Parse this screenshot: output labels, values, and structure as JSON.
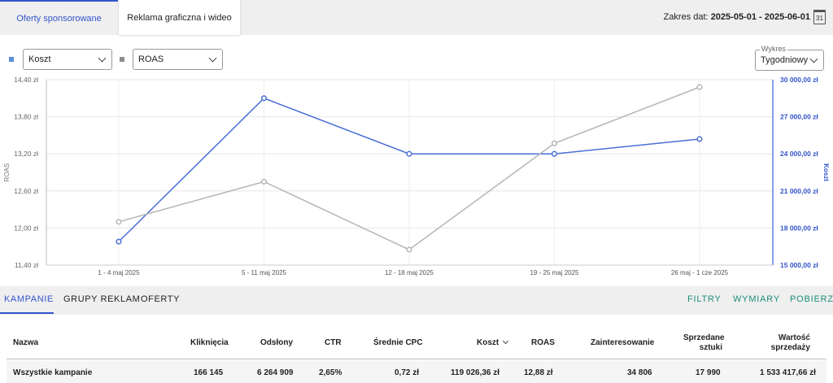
{
  "tabs": [
    {
      "label": "Oferty sponsorowane",
      "active": true
    },
    {
      "label": "Reklama graficzna i wideo",
      "active": false
    }
  ],
  "date_range": {
    "prefix": "Zakres dat:",
    "value": "2025-05-01 - 2025-06-01",
    "calendar_day": "31"
  },
  "controls": {
    "metric1": {
      "value": "Koszt",
      "color": "#5b8ed6"
    },
    "metric2": {
      "value": "ROAS",
      "color": "#8c8c8c"
    },
    "wykres": {
      "label": "Wykres",
      "value": "Tygodniowy"
    }
  },
  "chart_data": {
    "type": "line",
    "x": [
      "1 - 4 maj 2025",
      "5 - 11 maj 2025",
      "12 - 18 maj 2025",
      "19 - 25 maj 2025",
      "26 maj - 1 cze 2025"
    ],
    "y_left": {
      "label": "ROAS",
      "ticks": [
        "14,40 zł",
        "13,80 zł",
        "13,20 zł",
        "12,60 zł",
        "12,00 zł",
        "11,40 zł"
      ],
      "range": [
        11.4,
        14.4
      ]
    },
    "y_right": {
      "label": "Koszt",
      "ticks": [
        "30 000,00 zł",
        "27 000,00 zł",
        "24 000,00 zł",
        "21 000,00 zł",
        "18 000,00 zł",
        "15 000,00 zł"
      ],
      "range": [
        15000,
        30000
      ]
    },
    "grid": true,
    "series": [
      {
        "axis": "right",
        "color": "#4a6fd8",
        "values": [
          16900,
          28500,
          24000,
          24000,
          25200
        ]
      },
      {
        "axis": "left",
        "color": "#b5b5b5",
        "values": [
          12.1,
          12.75,
          11.65,
          13.37,
          14.28
        ]
      }
    ]
  },
  "subtabs": [
    "KAMPANIE",
    "GRUPY REKLAM",
    "OFERTY"
  ],
  "actions": [
    "FILTRY",
    "WYMIARY",
    "POBIERZ"
  ],
  "table": {
    "headers": {
      "nazwa": "Nazwa",
      "klikniecia": "Kliknięcia",
      "odslony": "Odsłony",
      "ctr": "CTR",
      "cpc": "Średnie CPC",
      "koszt": "Koszt",
      "roas": "ROAS",
      "zainteresowanie": "Zainteresowanie",
      "sprzedane_1": "Sprzedane",
      "sprzedane_2": "sztuki",
      "wartosc_1": "Wartość",
      "wartosc_2": "sprzedaży"
    },
    "row": {
      "nazwa": "Wszystkie kampanie",
      "klikniecia": "166 145",
      "odslony": "6 264 909",
      "ctr": "2,65%",
      "cpc": "0,72 zł",
      "koszt": "119 026,36 zł",
      "roas": "12,88 zł",
      "zainteresowanie": "34 806",
      "sprzedane": "17 990",
      "wartosc": "1 533 417,66 zł"
    }
  }
}
